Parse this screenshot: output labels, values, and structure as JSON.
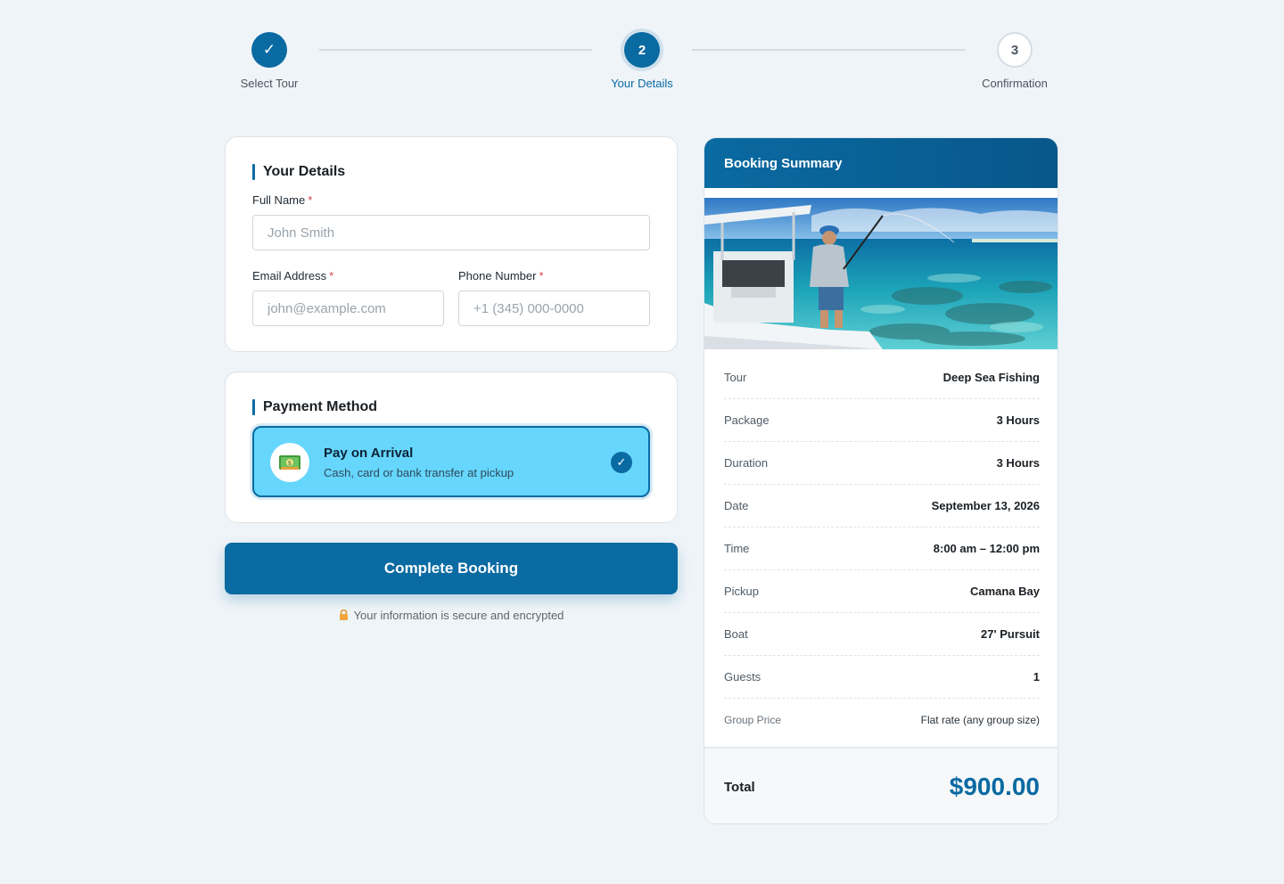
{
  "stepper": {
    "steps": [
      {
        "label": "Select Tour",
        "marker": "✓",
        "state": "done"
      },
      {
        "label": "Your Details",
        "marker": "2",
        "state": "active"
      },
      {
        "label": "Confirmation",
        "marker": "3",
        "state": "upcoming"
      }
    ]
  },
  "details": {
    "title": "Your Details",
    "full_name_label": "Full Name",
    "full_name_placeholder": "John Smith",
    "email_label": "Email Address",
    "email_placeholder": "john@example.com",
    "phone_label": "Phone Number",
    "phone_placeholder": "+1 (345) 000-0000",
    "required_mark": "*"
  },
  "payment": {
    "title": "Payment Method",
    "option_title": "Pay on Arrival",
    "option_subtitle": "Cash, card or bank transfer at pickup",
    "option_icon": "cash-icon",
    "check_mark": "✓"
  },
  "actions": {
    "complete_label": "Complete Booking",
    "secure_note": "Your information is secure and encrypted",
    "lock_icon": "lock-icon"
  },
  "summary": {
    "title": "Booking Summary",
    "photo": "fishing-boat-photo",
    "rows": [
      {
        "key": "Tour",
        "value": "Deep Sea Fishing"
      },
      {
        "key": "Package",
        "value": "3 Hours"
      },
      {
        "key": "Duration",
        "value": "3 Hours"
      },
      {
        "key": "Date",
        "value": "September 13, 2026"
      },
      {
        "key": "Time",
        "value": "8:00 am – 12:00 pm"
      },
      {
        "key": "Pickup",
        "value": "Camana Bay"
      },
      {
        "key": "Boat",
        "value": "27' Pursuit"
      },
      {
        "key": "Guests",
        "value": "1"
      },
      {
        "key": "Group Price",
        "value": "Flat rate (any group size)"
      }
    ],
    "total_label": "Total",
    "total_value": "$900.00"
  },
  "colors": {
    "primary": "#0a6aa2",
    "selected_option": "#66d6fc",
    "background": "#eff4f8",
    "required": "#d64545"
  }
}
